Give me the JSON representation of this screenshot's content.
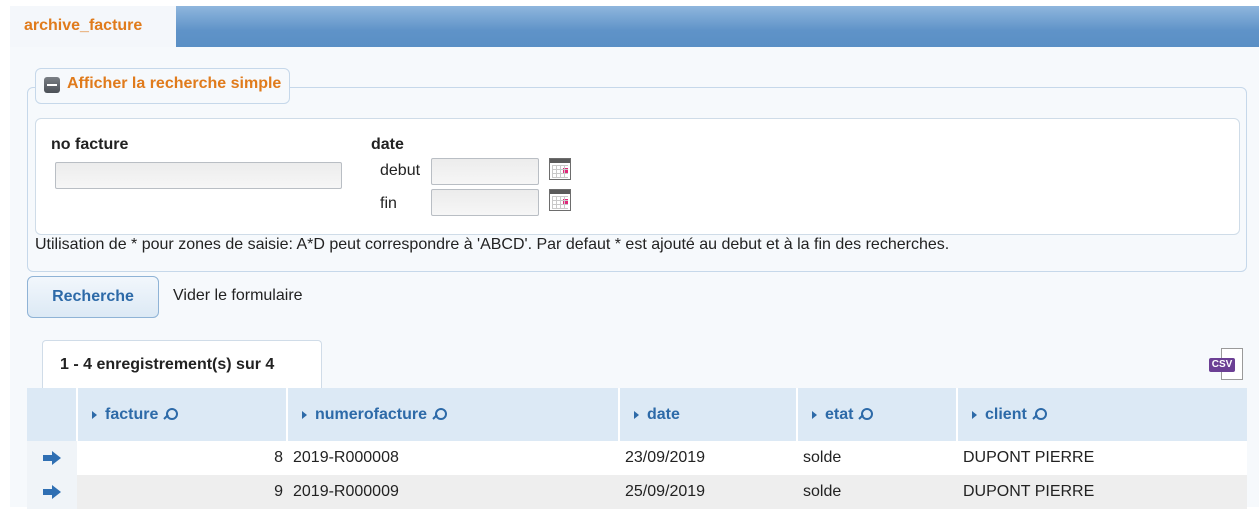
{
  "tabs": {
    "active_label": "archive_facture"
  },
  "search": {
    "toggle_label": "Afficher la recherche simple",
    "no_facture_label": "no facture",
    "date_label": "date",
    "debut_label": "debut",
    "fin_label": "fin",
    "no_facture_value": "",
    "debut_value": "",
    "fin_value": "",
    "help_text": "Utilisation de * pour zones de saisie: A*D peut correspondre à 'ABCD'. Par defaut * est ajouté au debut et à la fin des recherches.",
    "search_button": "Recherche",
    "clear_link": "Vider le formulaire"
  },
  "results": {
    "tab_label": "1 - 4 enregistrement(s) sur 4",
    "export_icon": "csv-export-icon",
    "columns": [
      "facture",
      "numerofacture",
      "date",
      "etat",
      "client"
    ],
    "rows": [
      {
        "facture": "8",
        "numerofacture": "2019-R000008",
        "date": "23/09/2019",
        "etat": "solde",
        "client": "DUPONT PIERRE"
      },
      {
        "facture": "9",
        "numerofacture": "2019-R000009",
        "date": "25/09/2019",
        "etat": "solde",
        "client": "DUPONT PIERRE"
      }
    ]
  },
  "colors": {
    "accent_orange": "#e07b1c",
    "link_blue": "#2d6aa8",
    "header_bg": "#dce9f5"
  }
}
